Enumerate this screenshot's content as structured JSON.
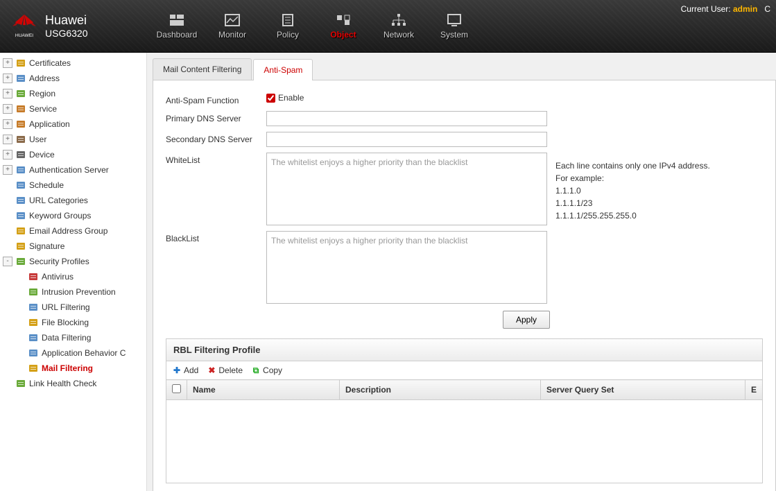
{
  "header": {
    "brand": "Huawei",
    "model": "USG6320",
    "currentUserLabel": "Current User:",
    "currentUser": "admin",
    "nav": [
      {
        "label": "Dashboard"
      },
      {
        "label": "Monitor"
      },
      {
        "label": "Policy"
      },
      {
        "label": "Object",
        "active": true
      },
      {
        "label": "Network"
      },
      {
        "label": "System"
      }
    ]
  },
  "sidebar": {
    "items": [
      {
        "label": "Certificates",
        "toggle": "+"
      },
      {
        "label": "Address",
        "toggle": "+"
      },
      {
        "label": "Region",
        "toggle": "+"
      },
      {
        "label": "Service",
        "toggle": "+"
      },
      {
        "label": "Application",
        "toggle": "+"
      },
      {
        "label": "User",
        "toggle": "+"
      },
      {
        "label": "Device",
        "toggle": "+"
      },
      {
        "label": "Authentication Server",
        "toggle": "+"
      },
      {
        "label": "Schedule",
        "child": true
      },
      {
        "label": "URL Categories",
        "child": true
      },
      {
        "label": "Keyword Groups",
        "child": true
      },
      {
        "label": "Email Address Group",
        "child": true
      },
      {
        "label": "Signature",
        "child": true
      },
      {
        "label": "Security Profiles",
        "toggle": "-"
      },
      {
        "label": "Antivirus",
        "child2": true
      },
      {
        "label": "Intrusion Prevention",
        "child2": true
      },
      {
        "label": "URL Filtering",
        "child2": true
      },
      {
        "label": "File Blocking",
        "child2": true
      },
      {
        "label": "Data Filtering",
        "child2": true
      },
      {
        "label": "Application Behavior C",
        "child2": true
      },
      {
        "label": "Mail Filtering",
        "child2": true,
        "selected": true
      },
      {
        "label": "Link Health Check",
        "child": true
      }
    ]
  },
  "tabs": [
    {
      "label": "Mail Content Filtering"
    },
    {
      "label": "Anti-Spam",
      "active": true
    }
  ],
  "form": {
    "antiSpamLabel": "Anti-Spam Function",
    "enableLabel": "Enable",
    "enableChecked": true,
    "primaryDnsLabel": "Primary DNS Server",
    "primaryDnsValue": "",
    "secondaryDnsLabel": "Secondary DNS Server",
    "secondaryDnsValue": "",
    "whitelistLabel": "WhiteList",
    "whitelistPlaceholder": "The whitelist enjoys a higher priority than the blacklist",
    "blacklistLabel": "BlackList",
    "blacklistPlaceholder": "The whitelist enjoys a higher priority than the blacklist",
    "hint": "Each line contains only one IPv4 address.\nFor example:\n1.1.1.0\n1.1.1.1/23\n1.1.1.1/255.255.255.0",
    "applyLabel": "Apply"
  },
  "rbl": {
    "title": "RBL Filtering Profile",
    "addLabel": "Add",
    "deleteLabel": "Delete",
    "copyLabel": "Copy",
    "columns": {
      "name": "Name",
      "description": "Description",
      "serverQuerySet": "Server Query Set",
      "extra": "E"
    }
  }
}
